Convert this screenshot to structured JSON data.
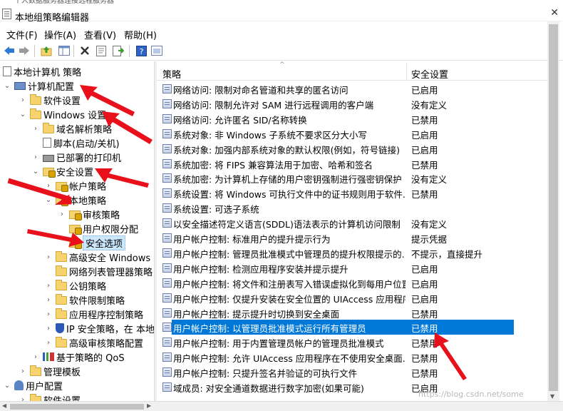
{
  "window": {
    "title": "本地组策略编辑器",
    "close_glyph": "✕",
    "top_strip_text": "个人数据服务器连接远程服务器"
  },
  "menu": {
    "items": [
      "文件(F)",
      "操作(A)",
      "查看(V)",
      "帮助(H)"
    ]
  },
  "toolbar": {
    "icons": [
      "back-arrow-icon",
      "forward-arrow-icon",
      "up-folder-icon",
      "show-hide-tree-icon",
      "delete-icon",
      "properties-icon",
      "export-list-icon",
      "help-icon",
      "view-icon"
    ]
  },
  "tree": {
    "items": [
      {
        "label": "本地计算机 策略",
        "icon": "doc",
        "expander": ""
      },
      {
        "label": "计算机配置",
        "icon": "computer",
        "expander": "⌄"
      },
      {
        "label": "软件设置",
        "icon": "folder",
        "expander": "›"
      },
      {
        "label": "Windows 设置",
        "icon": "folder",
        "expander": "⌄"
      },
      {
        "label": "域名解析策略",
        "icon": "folder",
        "expander": "›"
      },
      {
        "label": "脚本(启动/关机)",
        "icon": "doc",
        "expander": ""
      },
      {
        "label": "已部署的打印机",
        "icon": "printer",
        "expander": "›"
      },
      {
        "label": "安全设置",
        "icon": "lockfolder",
        "expander": "⌄"
      },
      {
        "label": "帐户策略",
        "icon": "lockfolder",
        "expander": "›"
      },
      {
        "label": "本地策略",
        "icon": "lockfolder",
        "expander": "⌄"
      },
      {
        "label": "审核策略",
        "icon": "lockfolder",
        "expander": "›"
      },
      {
        "label": "用户权限分配",
        "icon": "lockfolder",
        "expander": ""
      },
      {
        "label": "安全选项",
        "icon": "lockfolder",
        "expander": ""
      },
      {
        "label": "高级安全 Windows D",
        "icon": "folder",
        "expander": "›"
      },
      {
        "label": "网络列表管理器策略",
        "icon": "folder",
        "expander": ""
      },
      {
        "label": "公钥策略",
        "icon": "folder",
        "expander": "›"
      },
      {
        "label": "软件限制策略",
        "icon": "folder",
        "expander": "›"
      },
      {
        "label": "应用程序控制策略",
        "icon": "folder",
        "expander": "›"
      },
      {
        "label": "IP 安全策略，在 本地",
        "icon": "shield",
        "expander": "›"
      },
      {
        "label": "高级审核策略配置",
        "icon": "folder",
        "expander": "›"
      },
      {
        "label": "基于策略的 QoS",
        "icon": "chart",
        "expander": "›"
      },
      {
        "label": "管理模板",
        "icon": "folder",
        "expander": "›"
      },
      {
        "label": "用户配置",
        "icon": "user",
        "expander": "⌄"
      },
      {
        "label": "软件设置",
        "icon": "folder",
        "expander": "›"
      }
    ]
  },
  "list": {
    "columns": [
      "策略",
      "安全设置"
    ],
    "sort_arrow": "^",
    "rows": [
      {
        "name": "网络访问: 限制对命名管道和共享的匿名访问",
        "value": "已启用"
      },
      {
        "name": "网络访问: 限制允许对 SAM 进行远程调用的客户端",
        "value": "没有定义"
      },
      {
        "name": "网络访问: 允许匿名 SID/名称转换",
        "value": "已禁用"
      },
      {
        "name": "系统对象: 非 Windows 子系统不要求区分大小写",
        "value": "已启用"
      },
      {
        "name": "系统对象: 加强内部系统对象的默认权限(例如，符号链接)",
        "value": "已启用"
      },
      {
        "name": "系统加密: 将 FIPS 兼容算法用于加密、哈希和签名",
        "value": "已禁用"
      },
      {
        "name": "系统加密: 为计算机上存储的用户密钥强制进行强密钥保护",
        "value": "没有定义"
      },
      {
        "name": "系统设置: 将 Windows 可执行文件中的证书规则用于软件...",
        "value": "已禁用"
      },
      {
        "name": "系统设置: 可选子系统",
        "value": ""
      },
      {
        "name": "以安全描述符定义语言(SDDL)语法表示的计算机访问限制",
        "value": "没有定义"
      },
      {
        "name": "用户帐户控制: 标准用户的提升提示行为",
        "value": "提示凭据"
      },
      {
        "name": "用户帐户控制: 管理员批准模式中管理员的提升权限提示的...",
        "value": "不提示，直接提升"
      },
      {
        "name": "用户帐户控制: 检测应用程序安装并提示提升",
        "value": "已启用"
      },
      {
        "name": "用户帐户控制: 将文件和注册表写入错误虚拟化到每用户位置",
        "value": "已启用"
      },
      {
        "name": "用户帐户控制: 仅提升安装在安全位置的 UIAccess 应用程序",
        "value": "已启用"
      },
      {
        "name": "用户帐户控制: 提示提升时切换到安全桌面",
        "value": "已禁用"
      },
      {
        "name": "用户帐户控制: 以管理员批准模式运行所有管理员",
        "value": "已禁用"
      },
      {
        "name": "用户帐户控制: 用于内置管理员帐户的管理员批准模式",
        "value": "已禁用"
      },
      {
        "name": "用户帐户控制: 允许 UIAccess 应用程序在不使用安全桌面...",
        "value": "已禁用"
      },
      {
        "name": "用户帐户控制: 只提升签名并验证的可执行文件",
        "value": "已禁用"
      },
      {
        "name": "域成员: 对安全通道数据进行数字加密(如果可能)",
        "value": "已启用"
      }
    ],
    "selected_index": 16
  },
  "watermark": "https://blog.csdn.net/some",
  "colors": {
    "selection": "#0078d7",
    "annotation": "#e8101a"
  }
}
